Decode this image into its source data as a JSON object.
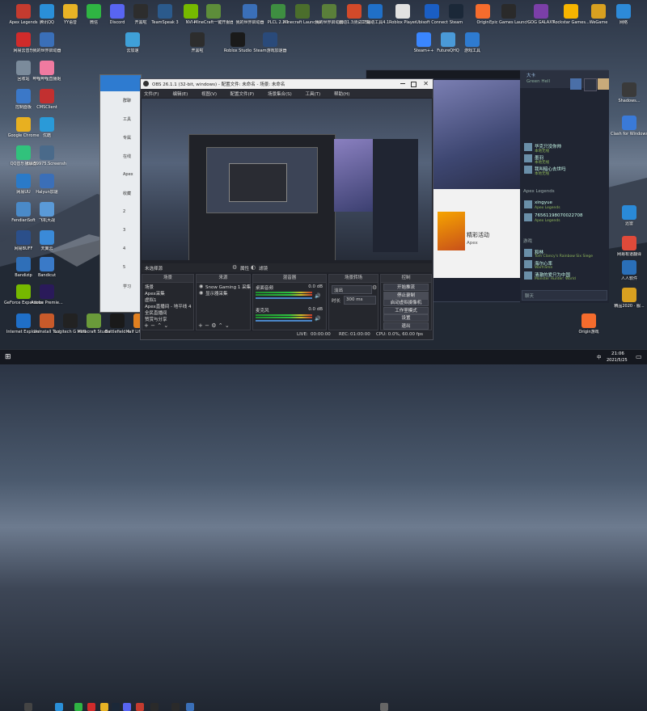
{
  "desktop_icons": [
    {
      "id": "apex",
      "label": "Apex Legends",
      "color": "#c43b2f"
    },
    {
      "id": "qq",
      "label": "腾讯QQ",
      "color": "#2a8fd8"
    },
    {
      "id": "yy",
      "label": "YY语音",
      "color": "#e8b325"
    },
    {
      "id": "wechat",
      "label": "微信",
      "color": "#2fb443"
    },
    {
      "id": "discord",
      "label": "Discord",
      "color": "#5865f2"
    },
    {
      "id": "kaiheila",
      "label": "开黑啦",
      "color": "#2d2d2d"
    },
    {
      "id": "teamspeak",
      "label": "TeamSpeak 3",
      "color": "#2b5a8c"
    },
    {
      "id": "nvidia",
      "label": "NVI+",
      "color": "#76b900"
    },
    {
      "id": "minecraft_server",
      "label": "MineCraft一键开服器1.",
      "color": "#5d8d3a"
    },
    {
      "id": "ga1",
      "label": "我的世界启动器",
      "color": "#3a6fb8"
    },
    {
      "id": "plc",
      "label": "PLCL 2.2.1",
      "color": "#3e8e41"
    },
    {
      "id": "mclauncher",
      "label": "Minecraft Launcher",
      "color": "#4b6e2c"
    },
    {
      "id": "mc_world",
      "label": "我的世界启动器",
      "color": "#5a7f3a"
    },
    {
      "id": "tool1",
      "label": "启动1.3测试工具",
      "color": "#d24a2a"
    },
    {
      "id": "cf",
      "label": "CF辅助工具4.1",
      "color": "#2070c8"
    },
    {
      "id": "roblox",
      "label": "Roblox Player",
      "color": "#e2e2e2"
    },
    {
      "id": "ubisoft",
      "label": "Ubisoft Connect",
      "color": "#1a5ec4"
    },
    {
      "id": "steam",
      "label": "Steam",
      "color": "#1b2838"
    },
    {
      "id": "origin",
      "label": "Origin",
      "color": "#f56c2d"
    },
    {
      "id": "epic",
      "label": "Epic Games Launcher",
      "color": "#2a2a2a"
    },
    {
      "id": "gog",
      "label": "GOG GALAXY",
      "color": "#7b3fa8"
    },
    {
      "id": "rockstar",
      "label": "Rockstar Games...",
      "color": "#f7b500"
    },
    {
      "id": "wegame",
      "label": "WeGame",
      "color": "#d8a020"
    },
    {
      "id": "wangluo",
      "label": "网络",
      "color": "#2d8ad8"
    },
    {
      "id": "wangyiyun",
      "label": "网易云音乐",
      "color": "#d02b2b"
    },
    {
      "id": "ga2",
      "label": "我的世界启动器",
      "color": "#3a6fb8"
    },
    {
      "id": "yunjiasu",
      "label": "云加速",
      "color": "#3fa0d8"
    },
    {
      "id": "kaiheila2",
      "label": "开黑啦",
      "color": "#2d2d2d"
    },
    {
      "id": "roblox_studio",
      "label": "Roblox Studio",
      "color": "#1a1a1a"
    },
    {
      "id": "steamcn",
      "label": "Steam游戏加速器",
      "color": "#2a4a7a"
    },
    {
      "id": "steampp",
      "label": "Steam++",
      "color": "#3a86ff"
    },
    {
      "id": "future",
      "label": "FutureQHQ",
      "color": "#4a9ad8"
    },
    {
      "id": "youxi",
      "label": "游戏工具",
      "color": "#2e7bd0"
    },
    {
      "id": "huishou",
      "label": "回收站",
      "color": "#7b8b9b"
    },
    {
      "id": "bili",
      "label": "哔哩哔哩直播姬",
      "color": "#f07aa0"
    },
    {
      "id": "kongzhi",
      "label": "控制面板",
      "color": "#3b78c8"
    },
    {
      "id": "cms",
      "label": "CMSClient",
      "color": "#c23030"
    },
    {
      "id": "chrome",
      "label": "Google Chrome",
      "color": "#e8b020"
    },
    {
      "id": "youku",
      "label": "优酷",
      "color": "#2a9ad8"
    },
    {
      "id": "qqmusic",
      "label": "QQ音乐播放器",
      "color": "#31c27c"
    },
    {
      "id": "shot",
      "label": "bai59975.Screenshot",
      "color": "#4a6a8a"
    },
    {
      "id": "wangyi",
      "label": "网易UU",
      "color": "#2a7ac8"
    },
    {
      "id": "haiyun",
      "label": "Halyun加速",
      "color": "#3b6fb8"
    },
    {
      "id": "fendian",
      "label": "FendianSoft",
      "color": "#4a8ac8"
    },
    {
      "id": "feiji",
      "label": "飞机大战",
      "color": "#5a9ad8"
    },
    {
      "id": "wangyi2",
      "label": "网易BUFF",
      "color": "#2b4f8a"
    },
    {
      "id": "tianyi",
      "label": "天翼云",
      "color": "#3a8ad8"
    },
    {
      "id": "bandizip",
      "label": "Bandizip",
      "color": "#2f6fb8"
    },
    {
      "id": "bandicam",
      "label": "Bandicut",
      "color": "#3a7ac8"
    },
    {
      "id": "geforce",
      "label": "GeForce Experience",
      "color": "#76b900"
    },
    {
      "id": "adobe",
      "label": "Adobe Premie...",
      "color": "#2a1a5a"
    },
    {
      "id": "ie",
      "label": "Internet Explorer",
      "color": "#1f6fc8"
    },
    {
      "id": "uninstall",
      "label": "Uninstall Tool",
      "color": "#c85a2a"
    },
    {
      "id": "logitech",
      "label": "Logitech G HUB",
      "color": "#222"
    },
    {
      "id": "mcstudio",
      "label": "Minecraft Studio",
      "color": "#6a9a3a"
    },
    {
      "id": "battlefield",
      "label": "Battlefield 4",
      "color": "#1a1a1a"
    },
    {
      "id": "halflife",
      "label": "Half Life Loose",
      "color": "#e08020"
    },
    {
      "id": "shadowsocks",
      "label": "Shadows...",
      "color": "#3a3a3a"
    },
    {
      "id": "clash",
      "label": "Clash for Windows",
      "color": "#3a7ad8"
    },
    {
      "id": "xunlei",
      "label": "迅雷",
      "color": "#2a8ad8"
    },
    {
      "id": "zaixian",
      "label": "网易有道翻译",
      "color": "#e04a3a"
    },
    {
      "id": "ruanjian",
      "label": "人人软件",
      "color": "#2a6fb8"
    },
    {
      "id": "jingdian",
      "label": "精品2020 · 服...",
      "color": "#d8a020"
    },
    {
      "id": "origin2",
      "label": "Origin游戏",
      "color": "#f56c2d"
    }
  ],
  "obs": {
    "title": "OBS 26.1.1 (32-bit, windows) - 配置文件: 未命名 - 场景: 未命名",
    "menu": [
      "文件(F)",
      "编辑(E)",
      "视图(V)",
      "配置文件(P)",
      "场景集合(S)",
      "工具(T)",
      "帮助(H)"
    ],
    "status_label": "未选择源",
    "props_button": "属性",
    "filters_button": "滤镜",
    "scenes_header": "场景",
    "scenes": [
      "场景",
      "Apex采集",
      "虚拟1",
      "Apex直播间 - 地平线 4",
      "全民直播间",
      "赞赏与分享"
    ],
    "sources_header": "来源",
    "sources": [
      "Snow Gaming 1 采集",
      "显示器采集"
    ],
    "mixer_header": "混音器",
    "mixer": [
      {
        "name": "桌面音频",
        "db": "0.0 dB"
      },
      {
        "name": "麦克风",
        "db": "0.0 dB"
      }
    ],
    "transitions_header": "场景转场",
    "transition_type": "淡出",
    "duration_label": "时长",
    "duration": "300 ms",
    "controls_header": "控制",
    "controls": [
      "开始推流",
      "停止录制",
      "启动虚拟摄像机",
      "工作室模式",
      "设置",
      "退出"
    ],
    "status_bar": {
      "live_label": "LIVE:",
      "live_time": "00:00:00",
      "rec_label": "REC:",
      "rec_time": "01:00:00",
      "cpu": "CPU: 0.0%, 60.00 fps"
    }
  },
  "right_panel": {
    "top_tag": "大卡",
    "top_sub": "Green Hell",
    "friends": [
      {
        "name": "华克只没你帅",
        "game": "本地无线"
      },
      {
        "name": "墨羽",
        "game": "本地无线"
      },
      {
        "name": "我叫暗心去世吗",
        "game": "本地无线"
      },
      {
        "name": "Apex Legends",
        "game": ""
      },
      {
        "name": "xingyue",
        "game": "Apex Legends"
      },
      {
        "name": "76561198070022708",
        "game": "Apex Legends"
      },
      {
        "name": "游戏",
        "game": ""
      },
      {
        "name": "和林",
        "game": "Tom Clancy's Rainbow Six Siege"
      },
      {
        "name": "海尔心率",
        "game": "Warframe"
      },
      {
        "name": "清澈的爱只为中国",
        "game": "Monster Hunter: World"
      }
    ],
    "search_label": "聊天"
  },
  "browser": {
    "ad_text": "精彩活动",
    "ad_sub": "Apex"
  },
  "chat_sidebar": [
    "群聊",
    "工具",
    "专属",
    "在线",
    "Apex",
    "收藏",
    "2",
    "3",
    "4",
    "5",
    "学习"
  ],
  "taskbar": {
    "time": "21:06",
    "date": "2021/5/25",
    "tray": [
      "中",
      "英"
    ]
  }
}
